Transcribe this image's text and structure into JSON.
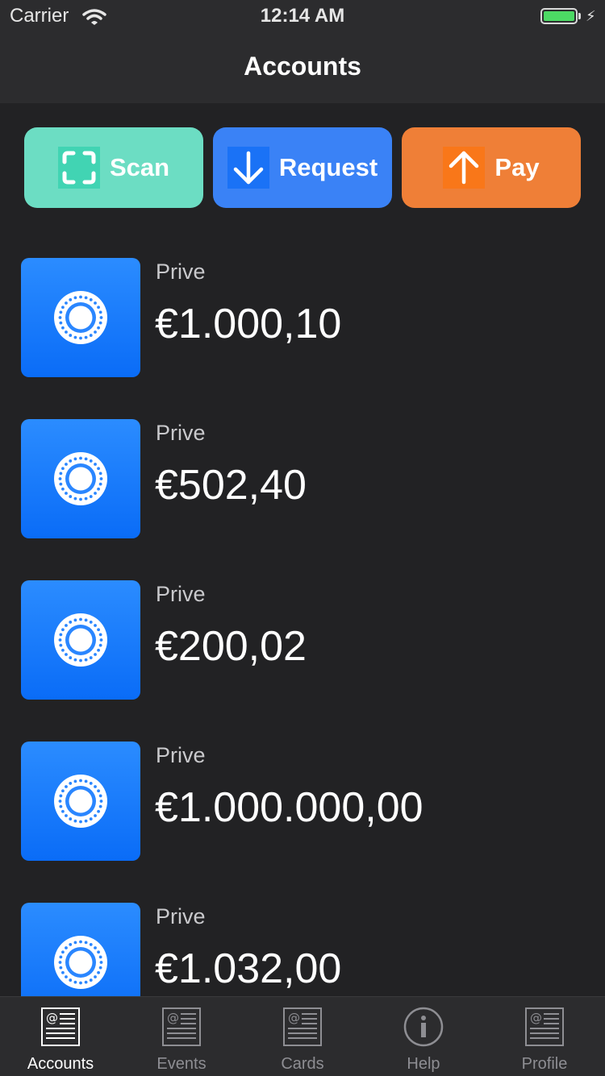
{
  "status_bar": {
    "carrier": "Carrier",
    "time": "12:14 AM",
    "battery_level": 1.0,
    "battery_color": "#4cd964"
  },
  "nav": {
    "title": "Accounts"
  },
  "actions": [
    {
      "label": "Scan",
      "icon": "scan-icon",
      "color": "#6cddc3"
    },
    {
      "label": "Request",
      "icon": "arrow-down-icon",
      "color": "#3a82f6"
    },
    {
      "label": "Pay",
      "icon": "arrow-up-icon",
      "color": "#ef7f37"
    }
  ],
  "accounts": [
    {
      "name": "Prive",
      "balance": "€1.000,10",
      "icon": "account-ring-icon"
    },
    {
      "name": "Prive",
      "balance": "€502,40",
      "icon": "account-ring-icon"
    },
    {
      "name": "Prive",
      "balance": "€200,02",
      "icon": "account-ring-icon"
    },
    {
      "name": "Prive",
      "balance": "€1.000.000,00",
      "icon": "account-ring-icon"
    },
    {
      "name": "Prive",
      "balance": "€1.032,00",
      "icon": "account-ring-icon"
    }
  ],
  "tabs": [
    {
      "label": "Accounts",
      "icon": "newspaper-icon",
      "active": true
    },
    {
      "label": "Events",
      "icon": "newspaper-icon",
      "active": false
    },
    {
      "label": "Cards",
      "icon": "newspaper-icon",
      "active": false
    },
    {
      "label": "Help",
      "icon": "info-icon",
      "active": false
    },
    {
      "label": "Profile",
      "icon": "newspaper-icon",
      "active": false
    }
  ]
}
